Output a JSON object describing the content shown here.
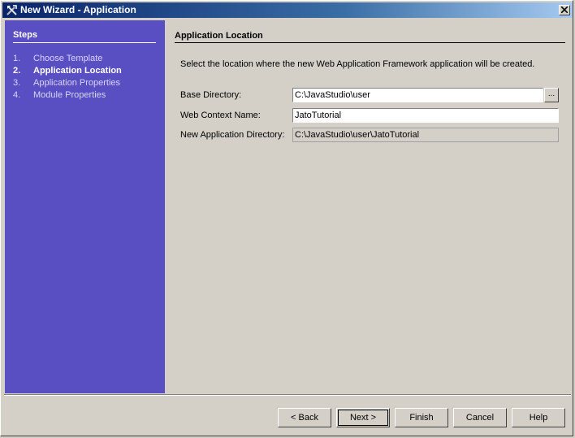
{
  "window": {
    "title": "New Wizard - Application"
  },
  "steps": {
    "heading": "Steps",
    "items": [
      {
        "num": "1.",
        "label": "Choose Template"
      },
      {
        "num": "2.",
        "label": "Application Location"
      },
      {
        "num": "3.",
        "label": "Application Properties"
      },
      {
        "num": "4.",
        "label": "Module Properties"
      }
    ]
  },
  "panel": {
    "heading": "Application Location",
    "description": "Select the location where the new Web Application Framework application will be created.",
    "base_dir_label": "Base Directory:",
    "base_dir_value": "C:\\JavaStudio\\user",
    "browse_label": "...",
    "context_label": "Web Context Name:",
    "context_value": "JatoTutorial",
    "app_dir_label": "New Application Directory:",
    "app_dir_value": "C:\\JavaStudio\\user\\JatoTutorial"
  },
  "buttons": {
    "back": "< Back",
    "next": "Next >",
    "finish": "Finish",
    "cancel": "Cancel",
    "help": "Help"
  }
}
